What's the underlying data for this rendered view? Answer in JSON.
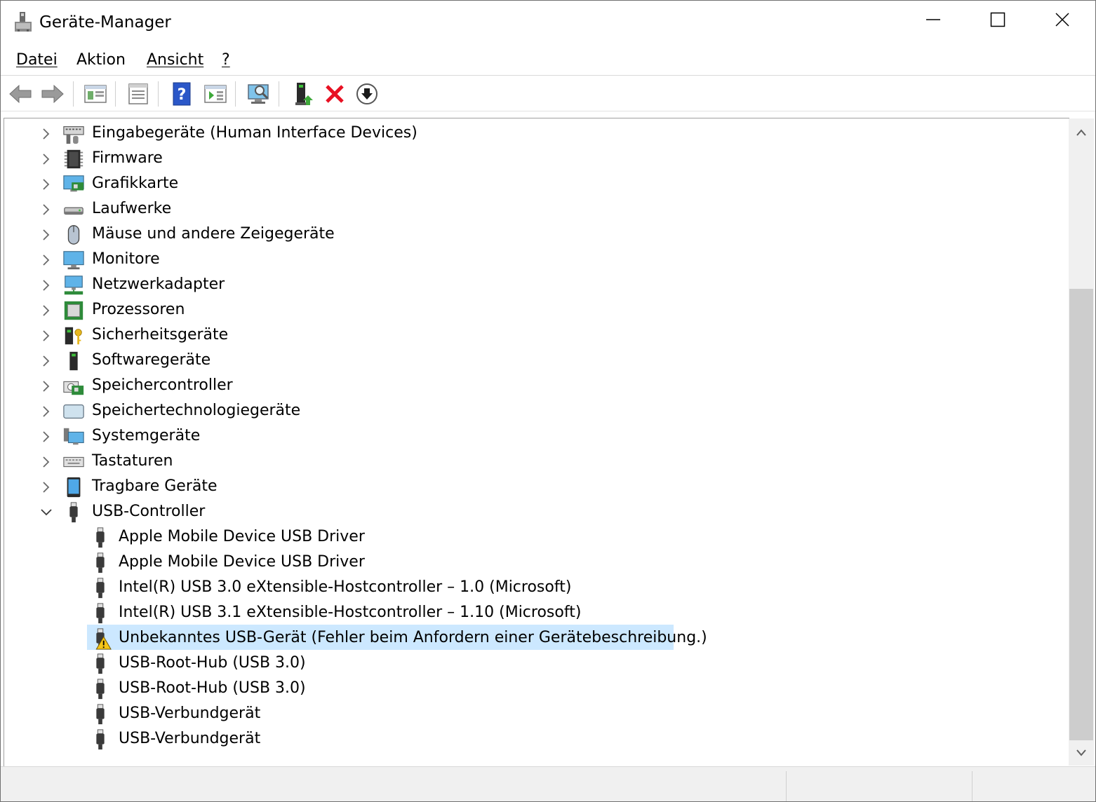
{
  "window": {
    "title": "Geräte-Manager"
  },
  "menu": {
    "datei": "Datei",
    "aktion": "Aktion",
    "ansicht": "Ansicht",
    "hilfe": "?"
  },
  "tree": {
    "categories": [
      {
        "label": "Eingabegeräte (Human Interface Devices)",
        "icon": "hid-icon"
      },
      {
        "label": "Firmware",
        "icon": "firmware-chip-icon"
      },
      {
        "label": "Grafikkarte",
        "icon": "display-adapter-icon"
      },
      {
        "label": "Laufwerke",
        "icon": "disk-drive-icon"
      },
      {
        "label": "Mäuse und andere Zeigegeräte",
        "icon": "mouse-icon"
      },
      {
        "label": "Monitore",
        "icon": "monitor-icon"
      },
      {
        "label": "Netzwerkadapter",
        "icon": "network-adapter-icon"
      },
      {
        "label": "Prozessoren",
        "icon": "processor-icon"
      },
      {
        "label": "Sicherheitsgeräte",
        "icon": "security-key-icon"
      },
      {
        "label": "Softwaregeräte",
        "icon": "software-device-icon"
      },
      {
        "label": "Speichercontroller",
        "icon": "storage-controller-icon"
      },
      {
        "label": "Speichertechnologiegeräte",
        "icon": "memory-technology-icon"
      },
      {
        "label": "Systemgeräte",
        "icon": "system-devices-icon"
      },
      {
        "label": "Tastaturen",
        "icon": "keyboard-icon"
      },
      {
        "label": "Tragbare Geräte",
        "icon": "portable-device-icon"
      },
      {
        "label": "USB-Controller",
        "icon": "usb-icon",
        "expanded": true
      }
    ],
    "usb_children": [
      {
        "label": "Apple Mobile Device USB Driver",
        "warning": false
      },
      {
        "label": "Apple Mobile Device USB Driver",
        "warning": false
      },
      {
        "label": "Intel(R) USB 3.0 eXtensible-Hostcontroller – 1.0 (Microsoft)",
        "warning": false
      },
      {
        "label": "Intel(R) USB 3.1 eXtensible-Hostcontroller – 1.10 (Microsoft)",
        "warning": false
      },
      {
        "label": "Unbekanntes USB-Gerät (Fehler beim Anfordern einer Gerätebeschreibung.)",
        "warning": true,
        "selected": true
      },
      {
        "label": "USB-Root-Hub (USB 3.0)",
        "warning": false
      },
      {
        "label": "USB-Root-Hub (USB 3.0)",
        "warning": false
      },
      {
        "label": "USB-Verbundgerät",
        "warning": false
      },
      {
        "label": "USB-Verbundgerät",
        "warning": false
      }
    ]
  },
  "colors": {
    "selection": "#cce8ff",
    "warning": "#f5c518",
    "uninstall_red": "#e81123",
    "help_blue": "#2b57c8"
  }
}
